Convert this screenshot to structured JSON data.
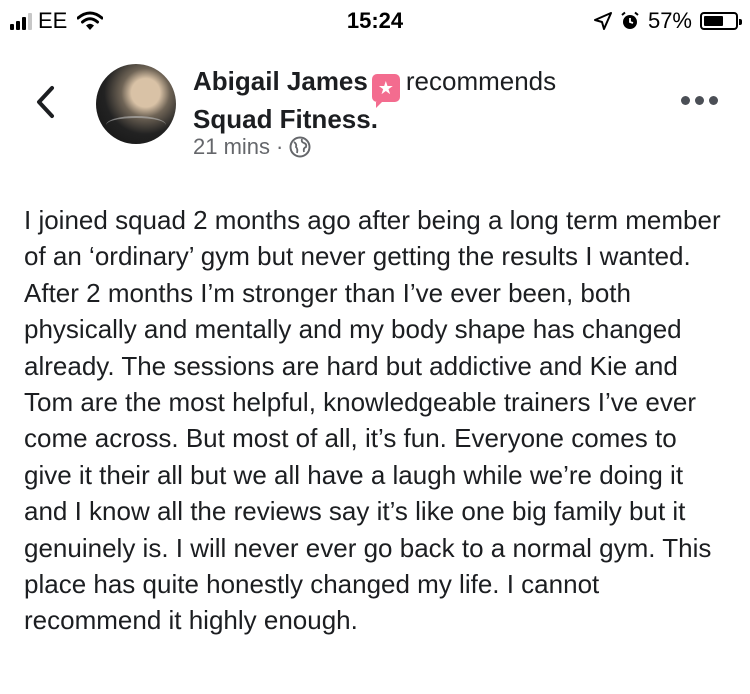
{
  "status_bar": {
    "carrier": "EE",
    "time": "15:24",
    "battery": "57%",
    "battery_level": 0.57,
    "icons": [
      "signal-icon",
      "wifi-icon",
      "location-arrow-icon",
      "alarm-icon",
      "battery-icon"
    ]
  },
  "post": {
    "author": "Abigail James",
    "action": "recommends",
    "page": "Squad Fitness.",
    "time": "21 mins",
    "separator": "·",
    "privacy_icon": "globe-icon",
    "body": "I joined squad 2 months ago after being a long term member of an ‘ordinary’ gym but never getting the results I wanted. After 2 months I’m stronger than I’ve ever been, both physically and mentally and my body shape has changed already. The sessions are hard but addictive and Kie and Tom are the most helpful, knowledgeable trainers I’ve ever come across. But most of all, it’s fun. Everyone comes to give it their all but we all have a laugh while we’re doing it and I know all the reviews say it’s like one big family but it genuinely is. I will never ever go back to a normal gym. This place has quite honestly changed my life. I cannot recommend it highly enough."
  },
  "colors": {
    "recommend_badge": "#f36c8f",
    "meta_text": "#65676b",
    "body_text": "#1c1e21"
  }
}
